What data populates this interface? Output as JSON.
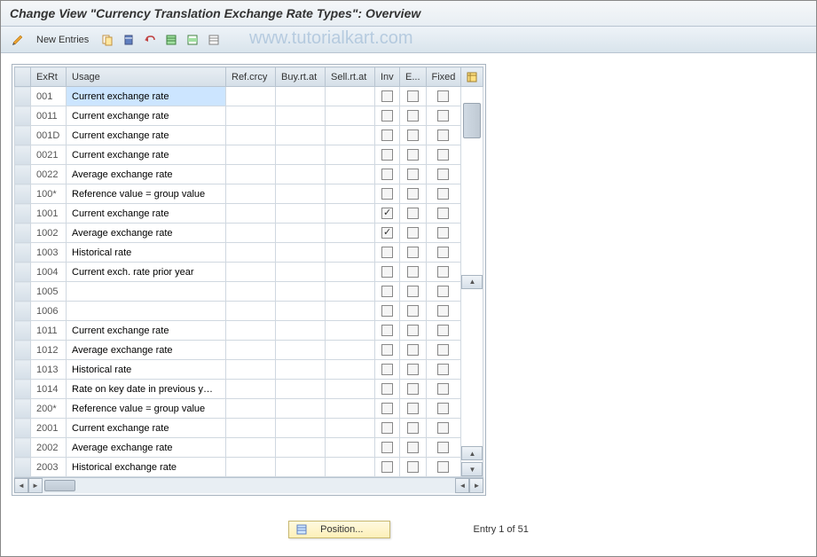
{
  "title": "Change View \"Currency Translation Exchange Rate Types\": Overview",
  "toolbar": {
    "new_entries": "New Entries"
  },
  "watermark": "www.tutorialkart.com",
  "headers": {
    "exrt": "ExRt",
    "usage": "Usage",
    "refcrcy": "Ref.crcy",
    "buy": "Buy.rt.at",
    "sell": "Sell.rt.at",
    "inv": "Inv",
    "e": "E...",
    "fixed": "Fixed"
  },
  "rows": [
    {
      "exrt": "001",
      "usage": "Current exchange rate",
      "ref": "",
      "buy": "",
      "sell": "",
      "inv": false,
      "e": false,
      "fixed": false,
      "selected": true
    },
    {
      "exrt": "0011",
      "usage": "Current exchange rate",
      "ref": "",
      "buy": "",
      "sell": "",
      "inv": false,
      "e": false,
      "fixed": false
    },
    {
      "exrt": "001D",
      "usage": "Current exchange rate",
      "ref": "",
      "buy": "",
      "sell": "",
      "inv": false,
      "e": false,
      "fixed": false
    },
    {
      "exrt": "0021",
      "usage": "Current exchange rate",
      "ref": "",
      "buy": "",
      "sell": "",
      "inv": false,
      "e": false,
      "fixed": false
    },
    {
      "exrt": "0022",
      "usage": "Average exchange rate",
      "ref": "",
      "buy": "",
      "sell": "",
      "inv": false,
      "e": false,
      "fixed": false
    },
    {
      "exrt": "100*",
      "usage": "Reference value = group value",
      "ref": "",
      "buy": "",
      "sell": "",
      "inv": false,
      "e": false,
      "fixed": false
    },
    {
      "exrt": "1001",
      "usage": "Current exchange rate",
      "ref": "",
      "buy": "",
      "sell": "",
      "inv": true,
      "e": false,
      "fixed": false
    },
    {
      "exrt": "1002",
      "usage": "Average exchange rate",
      "ref": "",
      "buy": "",
      "sell": "",
      "inv": true,
      "e": false,
      "fixed": false
    },
    {
      "exrt": "1003",
      "usage": "Historical rate",
      "ref": "",
      "buy": "",
      "sell": "",
      "inv": false,
      "e": false,
      "fixed": false
    },
    {
      "exrt": "1004",
      "usage": "Current exch. rate prior year",
      "ref": "",
      "buy": "",
      "sell": "",
      "inv": false,
      "e": false,
      "fixed": false
    },
    {
      "exrt": "1005",
      "usage": "",
      "ref": "",
      "buy": "",
      "sell": "",
      "inv": false,
      "e": false,
      "fixed": false
    },
    {
      "exrt": "1006",
      "usage": "",
      "ref": "",
      "buy": "",
      "sell": "",
      "inv": false,
      "e": false,
      "fixed": false
    },
    {
      "exrt": "1011",
      "usage": "Current exchange rate",
      "ref": "",
      "buy": "",
      "sell": "",
      "inv": false,
      "e": false,
      "fixed": false
    },
    {
      "exrt": "1012",
      "usage": "Average exchange rate",
      "ref": "",
      "buy": "",
      "sell": "",
      "inv": false,
      "e": false,
      "fixed": false
    },
    {
      "exrt": "1013",
      "usage": "Historical rate",
      "ref": "",
      "buy": "",
      "sell": "",
      "inv": false,
      "e": false,
      "fixed": false
    },
    {
      "exrt": "1014",
      "usage": "Rate on key date in previous y…",
      "ref": "",
      "buy": "",
      "sell": "",
      "inv": false,
      "e": false,
      "fixed": false
    },
    {
      "exrt": "200*",
      "usage": "Reference value = group value",
      "ref": "",
      "buy": "",
      "sell": "",
      "inv": false,
      "e": false,
      "fixed": false
    },
    {
      "exrt": "2001",
      "usage": "Current exchange rate",
      "ref": "",
      "buy": "",
      "sell": "",
      "inv": false,
      "e": false,
      "fixed": false
    },
    {
      "exrt": "2002",
      "usage": "Average exchange rate",
      "ref": "",
      "buy": "",
      "sell": "",
      "inv": false,
      "e": false,
      "fixed": false
    },
    {
      "exrt": "2003",
      "usage": "Historical exchange rate",
      "ref": "",
      "buy": "",
      "sell": "",
      "inv": false,
      "e": false,
      "fixed": false
    }
  ],
  "footer": {
    "position_label": "Position...",
    "entry_info": "Entry 1 of 51"
  }
}
